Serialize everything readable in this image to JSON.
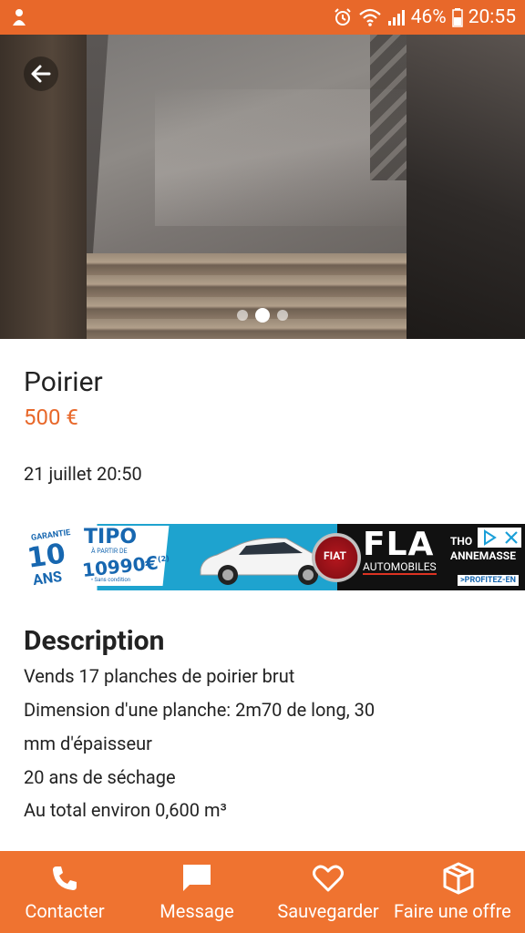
{
  "status_bar": {
    "battery_percent": "46%",
    "time": "20:55",
    "icons": [
      "app-notification-icon",
      "alarm-icon",
      "wifi-icon",
      "signal-icon",
      "battery-icon"
    ]
  },
  "listing": {
    "carousel": {
      "count": 3,
      "active_index": 1
    },
    "title": "Poirier",
    "price": "500 €",
    "date": "21 juillet 20:50"
  },
  "ad": {
    "guarantee_label": "GARANTIE",
    "guarantee_years": "10",
    "guarantee_unit": "ANS",
    "model": "TIPO",
    "from_label": "À PARTIR DE",
    "model_price": "10990€",
    "price_note": "(2)",
    "condition": "• Sans condition",
    "brand": "FIAT",
    "dealer": "FLA",
    "dealer_sub": "AUTOMOBILES",
    "city_line1": "THO",
    "city_line2": "ANNEMASSE",
    "cta": ">PROFITEZ-EN"
  },
  "description": {
    "heading": "Description",
    "lines": [
      "Vends 17 planches de poirier brut",
      "Dimension d'une planche: 2m70 de long, 30",
      "mm d'épaisseur",
      "20 ans de séchage",
      "Au total environ 0,600 m³"
    ]
  },
  "actions": [
    {
      "label": "Contacter",
      "icon": "phone-icon"
    },
    {
      "label": "Message",
      "icon": "message-icon"
    },
    {
      "label": "Sauvegarder",
      "icon": "heart-icon"
    },
    {
      "label": "Faire une offre",
      "icon": "offer-box-icon"
    }
  ],
  "colors": {
    "accent": "#e8682a",
    "bottom_bar": "#ef7330",
    "price": "#e8682a"
  }
}
